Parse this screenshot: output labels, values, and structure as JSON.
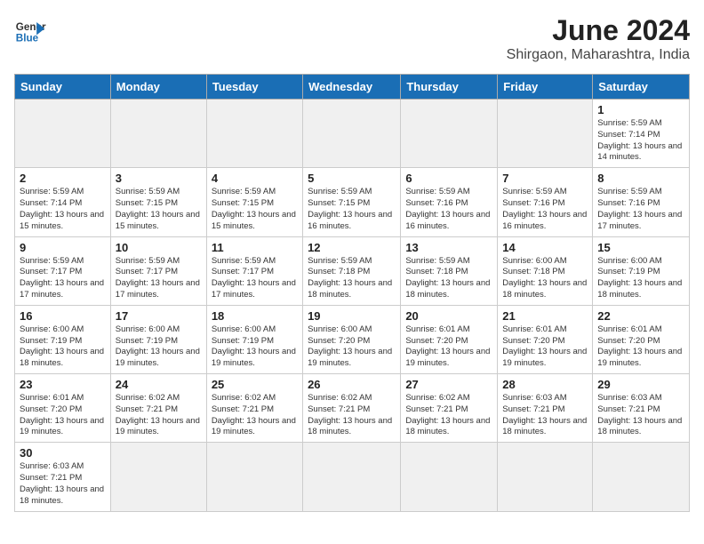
{
  "logo": {
    "text_general": "General",
    "text_blue": "Blue"
  },
  "title": "June 2024",
  "subtitle": "Shirgaon, Maharashtra, India",
  "days_of_week": [
    "Sunday",
    "Monday",
    "Tuesday",
    "Wednesday",
    "Thursday",
    "Friday",
    "Saturday"
  ],
  "weeks": [
    [
      {
        "day": "",
        "detail": "",
        "shade": true
      },
      {
        "day": "",
        "detail": "",
        "shade": true
      },
      {
        "day": "",
        "detail": "",
        "shade": true
      },
      {
        "day": "",
        "detail": "",
        "shade": true
      },
      {
        "day": "",
        "detail": "",
        "shade": true
      },
      {
        "day": "",
        "detail": "",
        "shade": true
      },
      {
        "day": "1",
        "detail": "Sunrise: 5:59 AM\nSunset: 7:14 PM\nDaylight: 13 hours and 14 minutes."
      }
    ],
    [
      {
        "day": "2",
        "detail": "Sunrise: 5:59 AM\nSunset: 7:14 PM\nDaylight: 13 hours and 15 minutes."
      },
      {
        "day": "3",
        "detail": "Sunrise: 5:59 AM\nSunset: 7:15 PM\nDaylight: 13 hours and 15 minutes."
      },
      {
        "day": "4",
        "detail": "Sunrise: 5:59 AM\nSunset: 7:15 PM\nDaylight: 13 hours and 15 minutes."
      },
      {
        "day": "5",
        "detail": "Sunrise: 5:59 AM\nSunset: 7:15 PM\nDaylight: 13 hours and 16 minutes."
      },
      {
        "day": "6",
        "detail": "Sunrise: 5:59 AM\nSunset: 7:16 PM\nDaylight: 13 hours and 16 minutes."
      },
      {
        "day": "7",
        "detail": "Sunrise: 5:59 AM\nSunset: 7:16 PM\nDaylight: 13 hours and 16 minutes."
      },
      {
        "day": "8",
        "detail": "Sunrise: 5:59 AM\nSunset: 7:16 PM\nDaylight: 13 hours and 17 minutes."
      }
    ],
    [
      {
        "day": "9",
        "detail": "Sunrise: 5:59 AM\nSunset: 7:17 PM\nDaylight: 13 hours and 17 minutes."
      },
      {
        "day": "10",
        "detail": "Sunrise: 5:59 AM\nSunset: 7:17 PM\nDaylight: 13 hours and 17 minutes."
      },
      {
        "day": "11",
        "detail": "Sunrise: 5:59 AM\nSunset: 7:17 PM\nDaylight: 13 hours and 17 minutes."
      },
      {
        "day": "12",
        "detail": "Sunrise: 5:59 AM\nSunset: 7:18 PM\nDaylight: 13 hours and 18 minutes."
      },
      {
        "day": "13",
        "detail": "Sunrise: 5:59 AM\nSunset: 7:18 PM\nDaylight: 13 hours and 18 minutes."
      },
      {
        "day": "14",
        "detail": "Sunrise: 6:00 AM\nSunset: 7:18 PM\nDaylight: 13 hours and 18 minutes."
      },
      {
        "day": "15",
        "detail": "Sunrise: 6:00 AM\nSunset: 7:19 PM\nDaylight: 13 hours and 18 minutes."
      }
    ],
    [
      {
        "day": "16",
        "detail": "Sunrise: 6:00 AM\nSunset: 7:19 PM\nDaylight: 13 hours and 18 minutes."
      },
      {
        "day": "17",
        "detail": "Sunrise: 6:00 AM\nSunset: 7:19 PM\nDaylight: 13 hours and 19 minutes."
      },
      {
        "day": "18",
        "detail": "Sunrise: 6:00 AM\nSunset: 7:19 PM\nDaylight: 13 hours and 19 minutes."
      },
      {
        "day": "19",
        "detail": "Sunrise: 6:00 AM\nSunset: 7:20 PM\nDaylight: 13 hours and 19 minutes."
      },
      {
        "day": "20",
        "detail": "Sunrise: 6:01 AM\nSunset: 7:20 PM\nDaylight: 13 hours and 19 minutes."
      },
      {
        "day": "21",
        "detail": "Sunrise: 6:01 AM\nSunset: 7:20 PM\nDaylight: 13 hours and 19 minutes."
      },
      {
        "day": "22",
        "detail": "Sunrise: 6:01 AM\nSunset: 7:20 PM\nDaylight: 13 hours and 19 minutes."
      }
    ],
    [
      {
        "day": "23",
        "detail": "Sunrise: 6:01 AM\nSunset: 7:20 PM\nDaylight: 13 hours and 19 minutes."
      },
      {
        "day": "24",
        "detail": "Sunrise: 6:02 AM\nSunset: 7:21 PM\nDaylight: 13 hours and 19 minutes."
      },
      {
        "day": "25",
        "detail": "Sunrise: 6:02 AM\nSunset: 7:21 PM\nDaylight: 13 hours and 19 minutes."
      },
      {
        "day": "26",
        "detail": "Sunrise: 6:02 AM\nSunset: 7:21 PM\nDaylight: 13 hours and 18 minutes."
      },
      {
        "day": "27",
        "detail": "Sunrise: 6:02 AM\nSunset: 7:21 PM\nDaylight: 13 hours and 18 minutes."
      },
      {
        "day": "28",
        "detail": "Sunrise: 6:03 AM\nSunset: 7:21 PM\nDaylight: 13 hours and 18 minutes."
      },
      {
        "day": "29",
        "detail": "Sunrise: 6:03 AM\nSunset: 7:21 PM\nDaylight: 13 hours and 18 minutes."
      }
    ],
    [
      {
        "day": "30",
        "detail": "Sunrise: 6:03 AM\nSunset: 7:21 PM\nDaylight: 13 hours and 18 minutes."
      },
      {
        "day": "",
        "detail": "",
        "shade": true
      },
      {
        "day": "",
        "detail": "",
        "shade": true
      },
      {
        "day": "",
        "detail": "",
        "shade": true
      },
      {
        "day": "",
        "detail": "",
        "shade": true
      },
      {
        "day": "",
        "detail": "",
        "shade": true
      },
      {
        "day": "",
        "detail": "",
        "shade": true
      }
    ]
  ]
}
